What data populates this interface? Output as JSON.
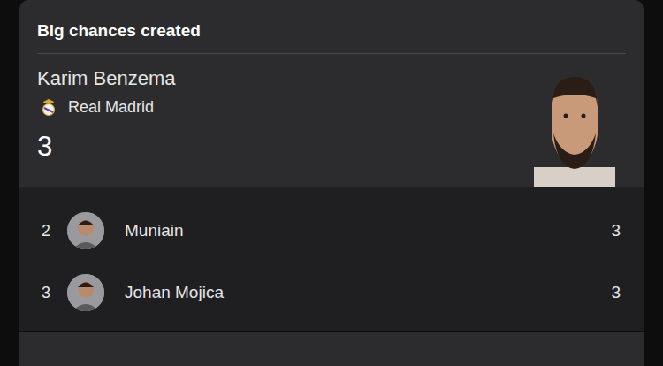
{
  "section": {
    "title": "Big chances created"
  },
  "leader": {
    "name": "Karim Benzema",
    "team": "Real Madrid",
    "value": "3"
  },
  "rows": [
    {
      "rank": "2",
      "name": "Muniain",
      "value": "3"
    },
    {
      "rank": "3",
      "name": "Johan Mojica",
      "value": "3"
    }
  ]
}
